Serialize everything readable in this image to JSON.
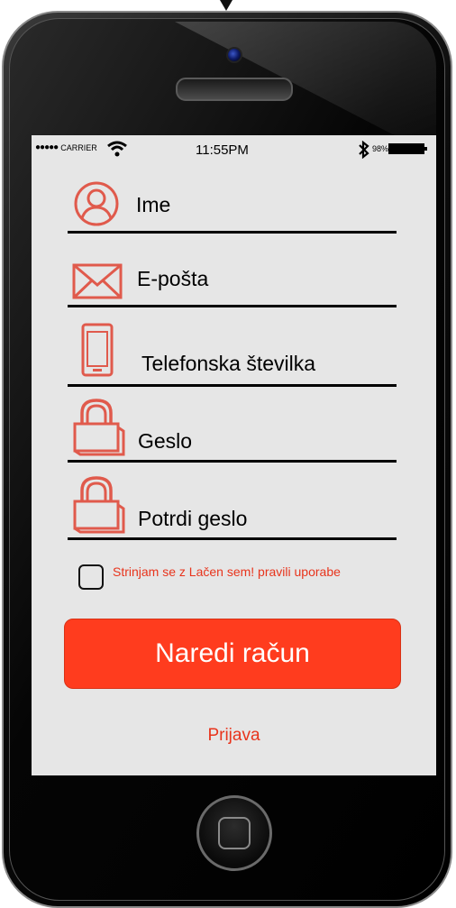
{
  "status_bar": {
    "carrier": "CARRIER",
    "time": "11:55PM",
    "battery_percent": "98%"
  },
  "form": {
    "fields": [
      {
        "label": "Ime",
        "icon": "user-icon"
      },
      {
        "label": "E-pošta",
        "icon": "envelope-icon"
      },
      {
        "label": "Telefonska številka",
        "icon": "phone-icon"
      },
      {
        "label": "Geslo",
        "icon": "lock-icon"
      },
      {
        "label": "Potrdi geslo",
        "icon": "lock-icon"
      }
    ],
    "terms_label": "Strinjam se z Lačen sem! pravili uporabe",
    "submit_label": "Naredi račun",
    "login_label": "Prijava"
  },
  "colors": {
    "accent": "#ff3c1e",
    "accent_text": "#e8341c",
    "icon": "#e05a4c",
    "screen_bg": "#e6e6e6"
  }
}
